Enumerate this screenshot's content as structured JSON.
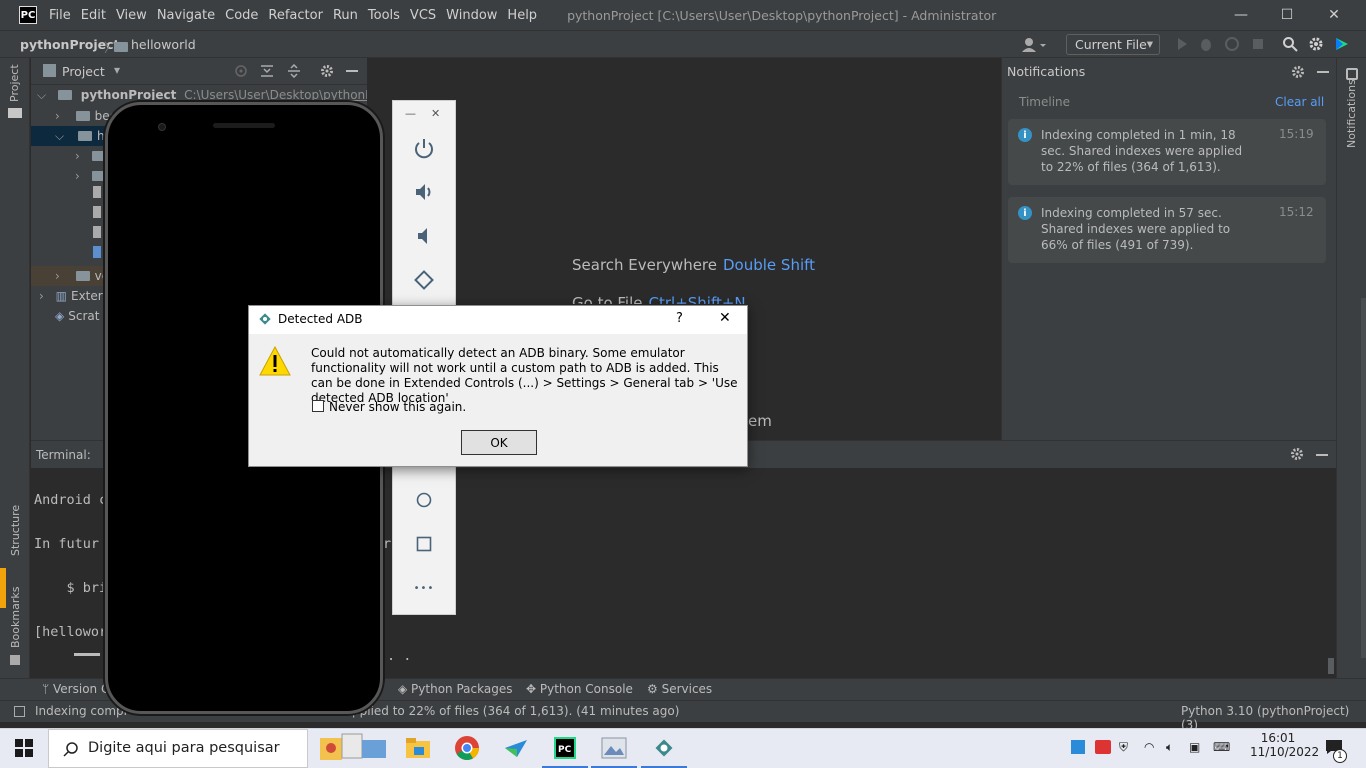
{
  "window": {
    "logo": "PC",
    "menu": [
      "File",
      "Edit",
      "View",
      "Navigate",
      "Code",
      "Refactor",
      "Run",
      "Tools",
      "VCS",
      "Window",
      "Help"
    ],
    "title": "pythonProject [C:\\Users\\User\\Desktop\\pythonProject] - Administrator",
    "controls": {
      "minimize": "—",
      "maximize": "☐",
      "close": "✕"
    }
  },
  "navbar": {
    "project": "pythonProject",
    "folder": "helloworld",
    "run_config": "Current File"
  },
  "left_stripe": {
    "project": "Project",
    "structure": "Structure",
    "bookmarks": "Bookmarks"
  },
  "project_panel": {
    "title": "Project",
    "root_name": "pythonProject",
    "root_path": "C:\\Users\\User\\Desktop\\pythonProject",
    "rows": [
      "bee",
      "he",
      "",
      "",
      "",
      "",
      "",
      "",
      "ve",
      "Exter",
      "Scrat"
    ]
  },
  "editor_hints": {
    "search_label": "Search Everywhere",
    "search_key": "Double Shift",
    "goto_label": "Go to File",
    "goto_key": "Ctrl+Shift+N",
    "partial_tail": "em"
  },
  "notifications": {
    "title": "Notifications",
    "timeline": "Timeline",
    "clear_all": "Clear all",
    "side_label": "Notifications",
    "items": [
      {
        "message": "Indexing completed in 1 min, 18 sec. Shared indexes were applied to 22% of files (364 of 1,613).",
        "time": "15:19"
      },
      {
        "message": "Indexing completed in 57 sec. Shared indexes were applied to 66% of files (491 of 739).",
        "time": "15:12"
      }
    ]
  },
  "terminal": {
    "label": "Terminal:",
    "lines": [
      "Android c",
      "In futur",
      "    $ bri",
      "[hellowor"
    ],
    "right_fragment": "r",
    "dots": ". ."
  },
  "bottom_tools": {
    "version_control": "Version C",
    "python_packages": "Python Packages",
    "python_console": "Python Console",
    "services": "Services"
  },
  "status": {
    "left_prefix": "Indexing compl",
    "left_suffix": "pplied to 22% of files (364 of 1,613). (41 minutes ago)",
    "interpreter": "Python 3.10 (pythonProject) (3)"
  },
  "emulator": {
    "window_min": "—",
    "window_close": "✕",
    "buttons": [
      "power-icon",
      "volume-up-icon",
      "volume-down-icon",
      "rotate-icon",
      "home-circle-icon",
      "overview-square-icon",
      "more-icon"
    ],
    "more_glyph": "•••"
  },
  "dialog": {
    "title": "Detected ADB",
    "help": "?",
    "close": "✕",
    "message": "Could not automatically detect an ADB binary. Some emulator functionality will not work until a custom path to ADB  is added. This can be done in Extended Controls (...) > Settings > General tab > 'Use detected ADB location'",
    "checkbox_label": "Never show this again.",
    "checkbox_checked": false,
    "ok": "OK"
  },
  "taskbar": {
    "search_placeholder": "Digite aqui para pesquisar",
    "time": "16:01",
    "date": "11/10/2022",
    "notification_count": "1"
  },
  "colors": {
    "accent_link": "#589df6",
    "selection": "#0d293e",
    "info_blue": "#3592c4",
    "warning_yellow": "#ffd800"
  }
}
